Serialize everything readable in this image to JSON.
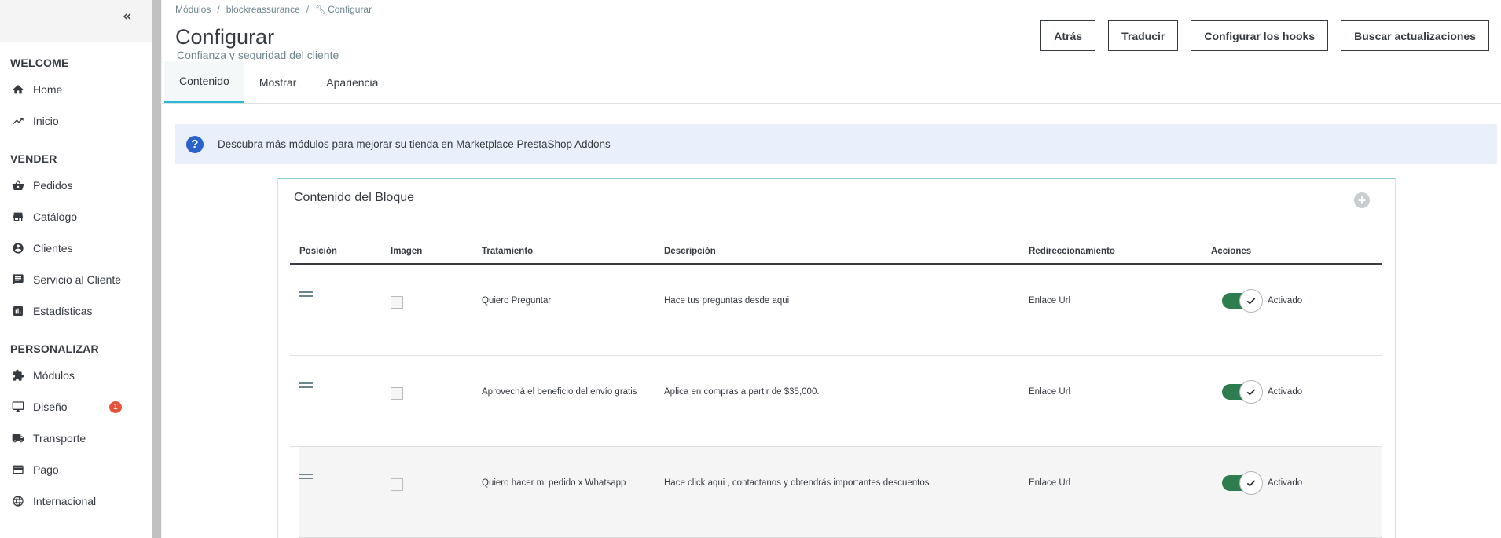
{
  "sidebar": {
    "collapse_glyph": "«",
    "sections": [
      {
        "title": "WELCOME",
        "items": [
          {
            "label": "Home",
            "icon": "home-icon"
          },
          {
            "label": "Inicio",
            "icon": "trending-icon"
          }
        ]
      },
      {
        "title": "VENDER",
        "items": [
          {
            "label": "Pedidos",
            "icon": "basket-icon"
          },
          {
            "label": "Catálogo",
            "icon": "store-icon"
          },
          {
            "label": "Clientes",
            "icon": "account-icon"
          },
          {
            "label": "Servicio al Cliente",
            "icon": "chat-icon"
          },
          {
            "label": "Estadísticas",
            "icon": "stats-icon"
          }
        ]
      },
      {
        "title": "PERSONALIZAR",
        "items": [
          {
            "label": "Módulos",
            "icon": "puzzle-icon"
          },
          {
            "label": "Diseño",
            "icon": "monitor-icon",
            "badge": "1"
          },
          {
            "label": "Transporte",
            "icon": "truck-icon"
          },
          {
            "label": "Pago",
            "icon": "card-icon"
          },
          {
            "label": "Internacional",
            "icon": "globe-icon"
          }
        ]
      }
    ]
  },
  "header": {
    "breadcrumb": [
      "Módulos",
      "blockreassurance",
      "Configurar"
    ],
    "title": "Configurar",
    "subtitle": "Confianza y seguridad del cliente",
    "buttons": [
      "Atrás",
      "Traducir",
      "Configurar los hooks",
      "Buscar actualizaciones"
    ]
  },
  "tabs": [
    {
      "label": "Contenido",
      "active": true
    },
    {
      "label": "Mostrar",
      "active": false
    },
    {
      "label": "Apariencia",
      "active": false
    }
  ],
  "alert": {
    "text": "Descubra más módulos para mejorar su tienda en",
    "link": "Marketplace PrestaShop Addons"
  },
  "card": {
    "title": "Contenido del Bloque",
    "add_glyph": "+",
    "columns": [
      "Posición",
      "Imagen",
      "Tratamiento",
      "Descripción",
      "Redireccionamiento",
      "Acciones"
    ],
    "rows": [
      {
        "tratamiento": "Quiero Preguntar",
        "descripcion": "Hace tus preguntas desde aqui",
        "redireccionamiento": "Enlace Url",
        "estado": "Activado"
      },
      {
        "tratamiento": "Aprovechá el beneficio del envío gratis",
        "descripcion": "Aplica en compras a partir de $35,000.",
        "redireccionamiento": "Enlace Url",
        "estado": "Activado"
      },
      {
        "tratamiento": "Quiero hacer mi pedido x Whatsapp",
        "descripcion": "Hace click aqui , contactanos y obtendrás importantes descuentos",
        "redireccionamiento": "Enlace Url",
        "estado": "Activado"
      }
    ]
  },
  "colors": {
    "accent": "#25b9d7",
    "switch_on": "#2e7d4f",
    "badge": "#e3533b",
    "alert_bg": "#e9f0fb",
    "alert_icon": "#2962c9"
  }
}
